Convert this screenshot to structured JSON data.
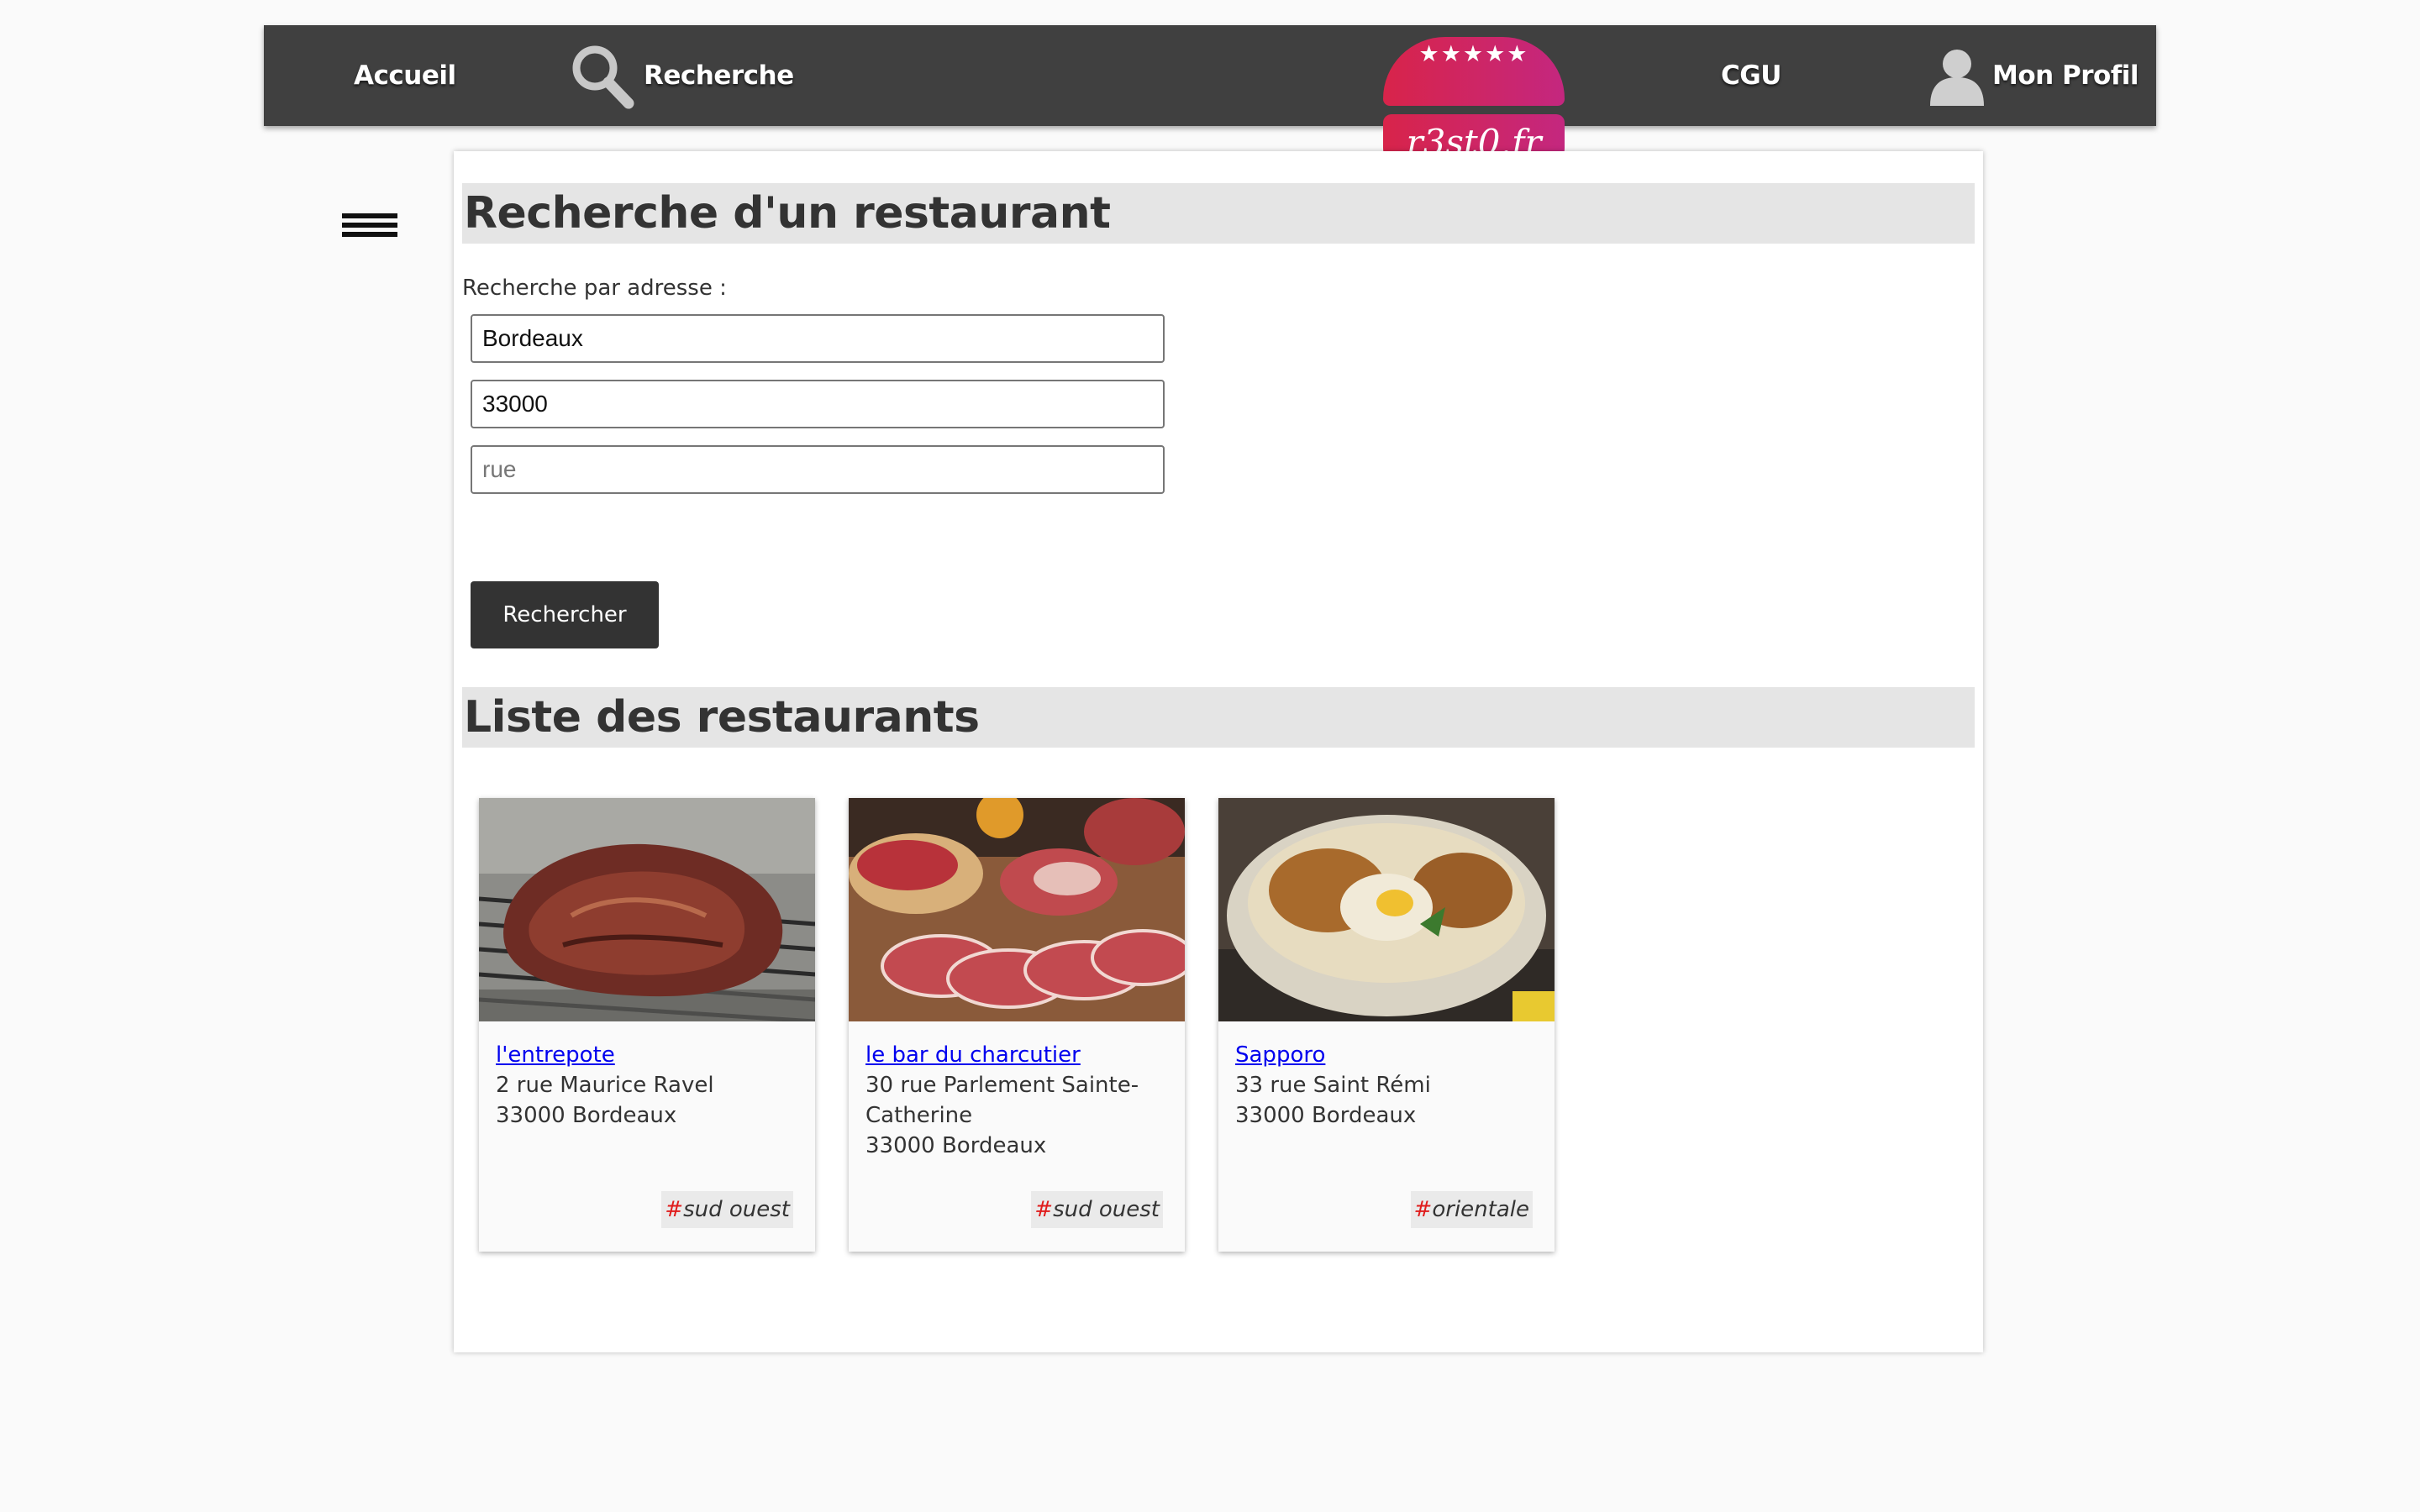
{
  "nav": {
    "home_label": "Accueil",
    "search_label": "Recherche",
    "cgu_label": "CGU",
    "profile_label": "Mon Profil",
    "logo_text": "r3st0.fr",
    "logo_stars": "★★★★★",
    "bar_color": "#404040",
    "logo_color": "#d8244a"
  },
  "icons": {
    "search": "search-icon",
    "profile": "user-icon",
    "menu": "hamburger-menu-icon"
  },
  "search": {
    "title": "Recherche d'un restaurant",
    "label": "Recherche par adresse :",
    "city_value": "Bordeaux",
    "zip_value": "33000",
    "street_value": "",
    "street_placeholder": "rue",
    "button_label": "Rechercher"
  },
  "list": {
    "title": "Liste des restaurants",
    "restaurants": [
      {
        "name": "l'entrepote",
        "street": "2 rue Maurice Ravel",
        "street_cont": "",
        "city": "33000 Bordeaux",
        "tag": "sud ouest"
      },
      {
        "name": "le bar du charcutier",
        "street": "30 rue Parlement Sainte-",
        "street_cont": "Catherine",
        "city": "33000 Bordeaux",
        "tag": "sud ouest"
      },
      {
        "name": "Sapporo",
        "street": "33 rue Saint Rémi",
        "street_cont": "",
        "city": "33000 Bordeaux",
        "tag": "orientale"
      }
    ]
  },
  "tag_prefix": "#",
  "tag_prefix_color": "#e01c1c"
}
